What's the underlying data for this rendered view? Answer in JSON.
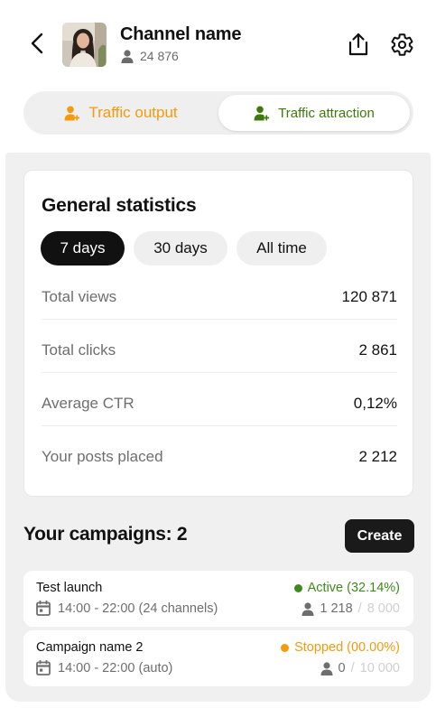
{
  "colors": {
    "accent_orange": "#f59a0c",
    "accent_green": "#3d7a0c",
    "active_green": "#3d8a1c",
    "stopped_orange": "#f59a0c"
  },
  "header": {
    "channel_name": "Channel name",
    "subscribers": "24 876",
    "icons": [
      "back-arrow-icon",
      "share-icon",
      "gear-icon",
      "user-icon"
    ]
  },
  "tabs": {
    "output_label": "Traffic output",
    "attraction_label": "Traffic attraction",
    "selected": "Traffic attraction"
  },
  "stats": {
    "title": "General statistics",
    "periods": [
      "7 days",
      "30 days",
      "All time"
    ],
    "selected_period": "7 days",
    "rows": [
      {
        "label": "Total views",
        "value": "120 871"
      },
      {
        "label": "Total clicks",
        "value": "2 861"
      },
      {
        "label": "Average CTR",
        "value": "0,12%"
      },
      {
        "label": "Your posts placed",
        "value": "2 212"
      }
    ]
  },
  "campaigns": {
    "title": "Your campaigns: 2",
    "create_label": "Create",
    "items": [
      {
        "name": "Test launch",
        "schedule": "14:00 - 22:00 (24 channels)",
        "status": "Active (32.14%)",
        "status_color": "#3d8a1c",
        "reach_current": "1 218",
        "reach_sep": "/",
        "reach_max": "8 000"
      },
      {
        "name": "Campaign name 2",
        "schedule": "14:00 - 22:00 (auto)",
        "status": "Stopped (00.00%)",
        "status_color": "#f59a0c",
        "reach_current": "0",
        "reach_sep": "/",
        "reach_max": "10 000"
      }
    ]
  }
}
